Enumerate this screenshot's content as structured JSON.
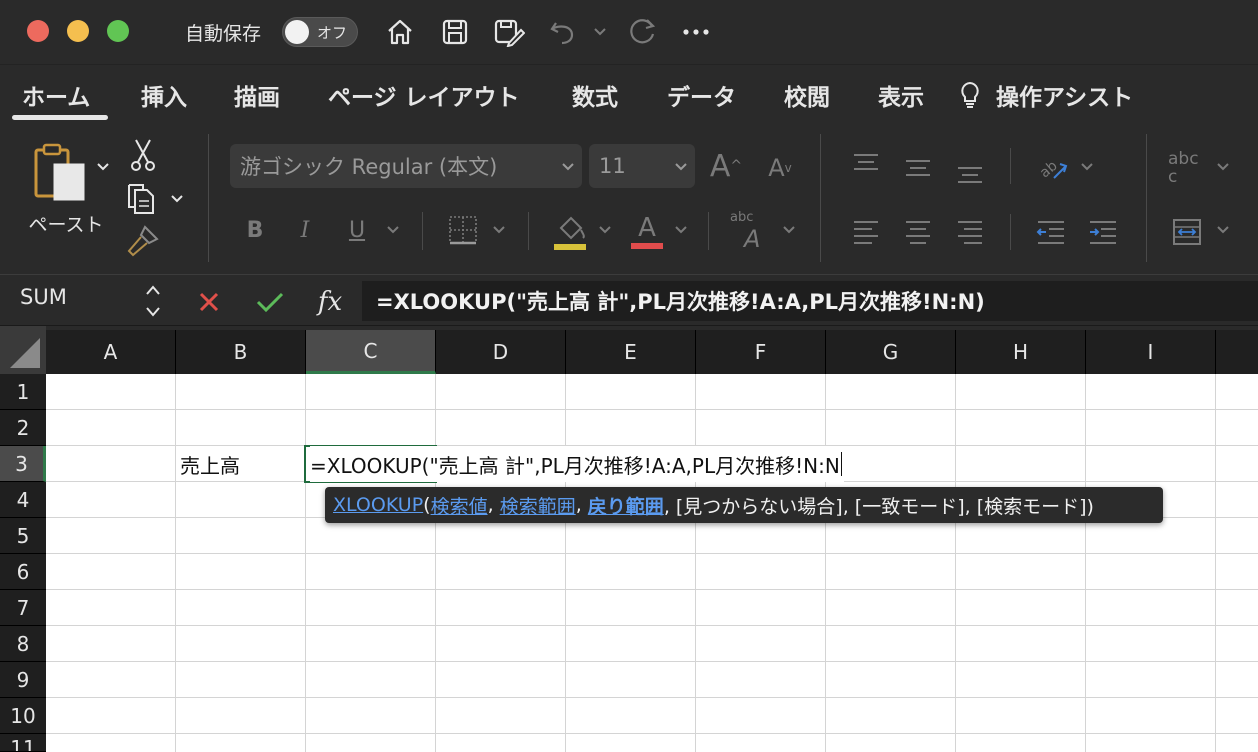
{
  "titlebar": {
    "autosave_label": "自動保存",
    "autosave_state": "オフ",
    "colors": {
      "close": "#ed6a5e",
      "minimize": "#f5bf4f",
      "zoom": "#61c554"
    }
  },
  "tabs": [
    {
      "label": "ホーム",
      "active": true
    },
    {
      "label": "挿入"
    },
    {
      "label": "描画"
    },
    {
      "label": "ページ レイアウト"
    },
    {
      "label": "数式"
    },
    {
      "label": "データ"
    },
    {
      "label": "校閲"
    },
    {
      "label": "表示"
    },
    {
      "label": "操作アシスト",
      "icon": "lightbulb-icon"
    }
  ],
  "ribbon": {
    "paste_label": "ペースト",
    "font_name": "游ゴシック Regular (本文)",
    "font_size": "11",
    "bold": "B",
    "italic": "I",
    "underline": "U",
    "font_grow": "A",
    "font_shrink": "A",
    "text_color_letter": "A",
    "phonetic_abc": "abc",
    "phonetic_a": "A",
    "wrap_abc": "abc",
    "wrap_c": "c",
    "fill_color": "#d8c23a",
    "text_color": "#e04c4c"
  },
  "formula_bar": {
    "name_box": "SUM",
    "fx_label": "fx",
    "formula": "=XLOOKUP(\"売上高 計\",PL月次推移!A:A,PL月次推移!N:N)"
  },
  "sheet": {
    "columns": [
      "A",
      "B",
      "C",
      "D",
      "E",
      "F",
      "G",
      "H",
      "I"
    ],
    "rows": [
      "1",
      "2",
      "3",
      "4",
      "5",
      "6",
      "7",
      "8",
      "9",
      "10",
      "11"
    ],
    "active_column": "C",
    "active_row": "3",
    "cells": {
      "B3": "売上高",
      "C3": "=XLOOKUP(\"売上高 計\",PL月次推移!A:A,PL月次推移!N:N"
    }
  },
  "tooltip": {
    "function": "XLOOKUP",
    "open_paren": "(",
    "arg1": "検索値",
    "comma1": ", ",
    "arg2": "検索範囲",
    "comma2": ", ",
    "arg3": "戻り範囲",
    "rest": ", [見つからない場合], [一致モード], [検索モード])"
  }
}
